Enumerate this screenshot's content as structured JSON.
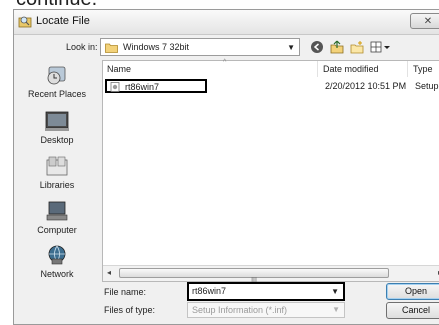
{
  "caption": "continue.",
  "window": {
    "title": "Locate File",
    "close_glyph": "✕"
  },
  "lookin": {
    "label": "Look in:",
    "value": "Windows 7 32bit",
    "dropdown_glyph": "▼",
    "toolbar_icons": [
      "back-icon",
      "up-folder-icon",
      "new-folder-icon",
      "view-menu-icon"
    ]
  },
  "places": [
    {
      "label": "Recent Places",
      "icon": "recent-places-icon"
    },
    {
      "label": "Desktop",
      "icon": "desktop-icon"
    },
    {
      "label": "Libraries",
      "icon": "libraries-icon"
    },
    {
      "label": "Computer",
      "icon": "computer-icon"
    },
    {
      "label": "Network",
      "icon": "network-icon"
    }
  ],
  "filelist": {
    "columns": [
      "Name",
      "Date modified",
      "Type"
    ],
    "rows": [
      {
        "name": "rt86win7",
        "date": "2/20/2012 10:51 PM",
        "type": "Setup Inf"
      }
    ],
    "scroll_grip": "III",
    "scroll_left": "◂",
    "scroll_right": "▸"
  },
  "filename": {
    "label": "File name:",
    "value": "rt86win7",
    "dropdown_glyph": "▼"
  },
  "filetype": {
    "label": "Files of type:",
    "value": "Setup Information (*.inf)",
    "dropdown_glyph": "▼"
  },
  "buttons": {
    "open": "Open",
    "cancel": "Cancel"
  }
}
